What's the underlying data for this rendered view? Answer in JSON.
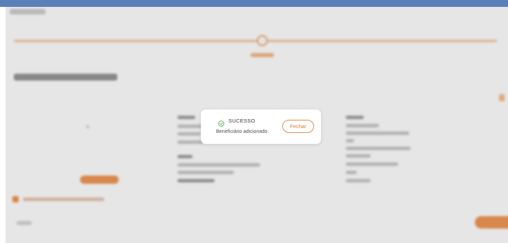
{
  "dialog": {
    "status": "SUCESSO",
    "message": "Beneficiário adicionado.",
    "close_label": "Fechar"
  },
  "colors": {
    "accent": "#e07b2f",
    "success": "#4caf50",
    "topbar": "#5b7fb8"
  }
}
